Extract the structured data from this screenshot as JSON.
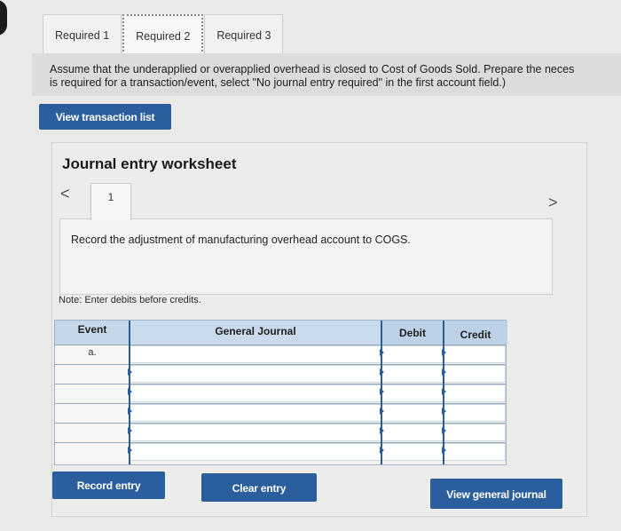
{
  "tabs": [
    {
      "label": "Required 1"
    },
    {
      "label": "Required 2"
    },
    {
      "label": "Required 3"
    }
  ],
  "instructions": {
    "line1": "Assume that the underapplied or overapplied overhead is closed to Cost of Goods Sold. Prepare the neces",
    "line2": "is required for a transaction/event, select \"No journal entry required\" in the first account field.)"
  },
  "view_transaction_list": "View transaction list",
  "worksheet": {
    "title": "Journal entry worksheet",
    "prev_glyph": "<",
    "next_glyph": ">",
    "step_number": "1",
    "step_text": "Record the adjustment of manufacturing overhead account to COGS.",
    "note": "Note: Enter debits before credits."
  },
  "table": {
    "headers": {
      "event": "Event",
      "general_journal": "General Journal",
      "debit": "Debit",
      "credit": "Credit"
    },
    "rows": [
      {
        "event": "a."
      },
      {
        "event": ""
      },
      {
        "event": ""
      },
      {
        "event": ""
      },
      {
        "event": ""
      },
      {
        "event": ""
      }
    ]
  },
  "buttons": {
    "record_entry": "Record entry",
    "clear_entry": "Clear entry",
    "view_general_journal": "View general journal"
  },
  "colors": {
    "button_blue": "#2a5e9c",
    "header_blue": "#bcd0e6"
  }
}
